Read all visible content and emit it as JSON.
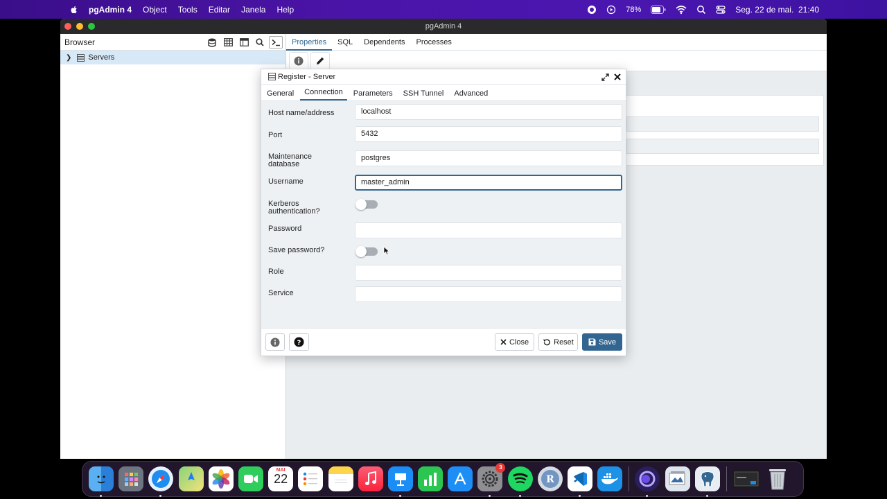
{
  "menubar": {
    "app_name": "pgAdmin 4",
    "items": [
      "Object",
      "Tools",
      "Editar",
      "Janela",
      "Help"
    ],
    "battery": "78%",
    "datetime": "Seg. 22 de mai.  21:40"
  },
  "window": {
    "title": "pgAdmin 4"
  },
  "browser": {
    "title": "Browser",
    "tree": [
      {
        "label": "Servers"
      }
    ]
  },
  "main": {
    "tabs": [
      {
        "label": "Properties",
        "active": true
      },
      {
        "label": "SQL"
      },
      {
        "label": "Dependents"
      },
      {
        "label": "Processes"
      }
    ]
  },
  "dialog": {
    "title": "Register - Server",
    "tabs": [
      {
        "label": "General"
      },
      {
        "label": "Connection",
        "active": true
      },
      {
        "label": "Parameters"
      },
      {
        "label": "SSH Tunnel"
      },
      {
        "label": "Advanced"
      }
    ],
    "fields": {
      "host": {
        "label": "Host name/address",
        "value": "localhost"
      },
      "port": {
        "label": "Port",
        "value": "5432"
      },
      "maintenance_db": {
        "label_line1": "Maintenance",
        "label_line2": "database",
        "value": "postgres"
      },
      "username": {
        "label": "Username",
        "value": "master_admin"
      },
      "kerberos": {
        "label_line1": "Kerberos",
        "label_line2": "authentication?",
        "enabled": false
      },
      "password": {
        "label": "Password",
        "value": ""
      },
      "save_password": {
        "label": "Save password?",
        "enabled": false
      },
      "role": {
        "label": "Role",
        "value": ""
      },
      "service": {
        "label": "Service",
        "value": ""
      }
    },
    "buttons": {
      "close": "Close",
      "reset": "Reset",
      "save": "Save"
    }
  },
  "colors": {
    "accent": "#326690",
    "menubar": "#4b14a8",
    "selection": "#d7e8f7"
  },
  "dock": {
    "settings_badge": "3",
    "calendar_month": "MAI",
    "calendar_day": "22",
    "apps": [
      "Finder",
      "Launchpad",
      "Safari",
      "Maps",
      "Photos",
      "FaceTime",
      "Calendar",
      "Reminders",
      "Notes",
      "Music",
      "Keynote",
      "Numbers",
      "App Store",
      "System Settings",
      "Spotify",
      "RStudio",
      "Visual Studio Code",
      "Docker",
      "Screen Recorder",
      "Preview",
      "pgAdmin",
      "Terminal",
      "Trash"
    ]
  }
}
